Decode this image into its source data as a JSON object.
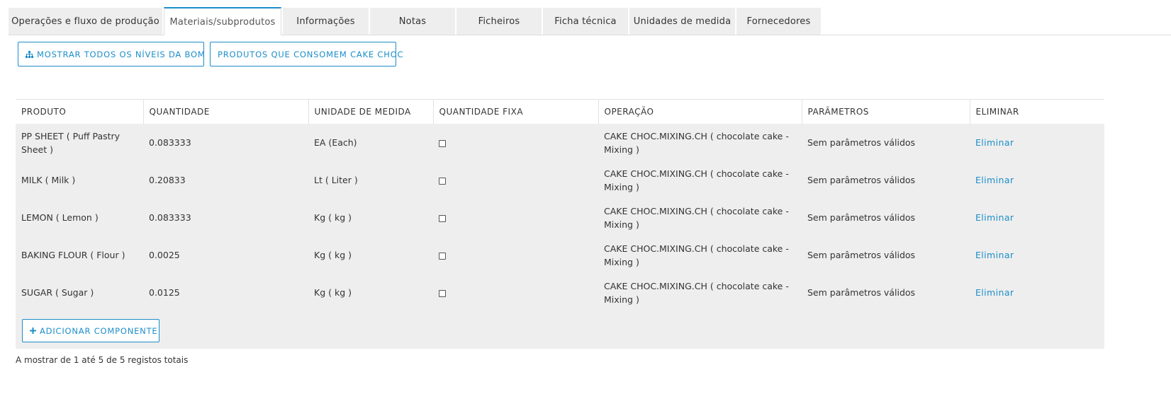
{
  "tabs": [
    {
      "label": "Operações e fluxo de produção",
      "active": false
    },
    {
      "label": "Materiais/subprodutos",
      "active": true
    },
    {
      "label": "Informações",
      "active": false
    },
    {
      "label": "Notas",
      "active": false
    },
    {
      "label": "Ficheiros",
      "active": false
    },
    {
      "label": "Ficha técnica",
      "active": false
    },
    {
      "label": "Unidades de medida",
      "active": false
    },
    {
      "label": "Fornecedores",
      "active": false
    }
  ],
  "toolbar": {
    "show_bom_label": "MOSTRAR TODOS OS NÍVEIS DA BOM",
    "consumers_label": "PRODUTOS QUE CONSOMEM CAKE CHOC"
  },
  "table": {
    "headers": [
      "PRODUTO",
      "QUANTIDADE",
      "UNIDADE DE MEDIDA",
      "QUANTIDADE FIXA",
      "OPERAÇÃO",
      "PARÂMETROS",
      "ELIMINAR"
    ],
    "rows": [
      {
        "produto": "PP SHEET ( Puff Pastry Sheet )",
        "quantidade": "0.083333",
        "unidade": "EA (Each)",
        "fixa": false,
        "operacao": "CAKE CHOC.MIXING.CH ( chocolate cake - Mixing )",
        "parametros": "Sem parâmetros válidos",
        "eliminar": "Eliminar"
      },
      {
        "produto": "MILK ( Milk )",
        "quantidade": "0.20833",
        "unidade": "Lt ( Liter )",
        "fixa": false,
        "operacao": "CAKE CHOC.MIXING.CH ( chocolate cake - Mixing )",
        "parametros": "Sem parâmetros válidos",
        "eliminar": "Eliminar"
      },
      {
        "produto": "LEMON ( Lemon )",
        "quantidade": "0.083333",
        "unidade": "Kg ( kg )",
        "fixa": false,
        "operacao": "CAKE CHOC.MIXING.CH ( chocolate cake - Mixing )",
        "parametros": "Sem parâmetros válidos",
        "eliminar": "Eliminar"
      },
      {
        "produto": "BAKING FLOUR ( Flour )",
        "quantidade": "0.0025",
        "unidade": "Kg ( kg )",
        "fixa": false,
        "operacao": "CAKE CHOC.MIXING.CH ( chocolate cake - Mixing )",
        "parametros": "Sem parâmetros válidos",
        "eliminar": "Eliminar"
      },
      {
        "produto": "SUGAR ( Sugar )",
        "quantidade": "0.0125",
        "unidade": "Kg ( kg )",
        "fixa": false,
        "operacao": "CAKE CHOC.MIXING.CH ( chocolate cake - Mixing )",
        "parametros": "Sem parâmetros válidos",
        "eliminar": "Eliminar"
      }
    ]
  },
  "add_component_label": "ADICIONAR COMPONENTE",
  "status_text": "A mostrar de 1 até 5 de 5 registos totais",
  "icons": {
    "bom": "sitemap-icon",
    "add": "plus-icon"
  },
  "colors": {
    "accent": "#1c8ec9",
    "row_bg": "#eeeeee"
  }
}
